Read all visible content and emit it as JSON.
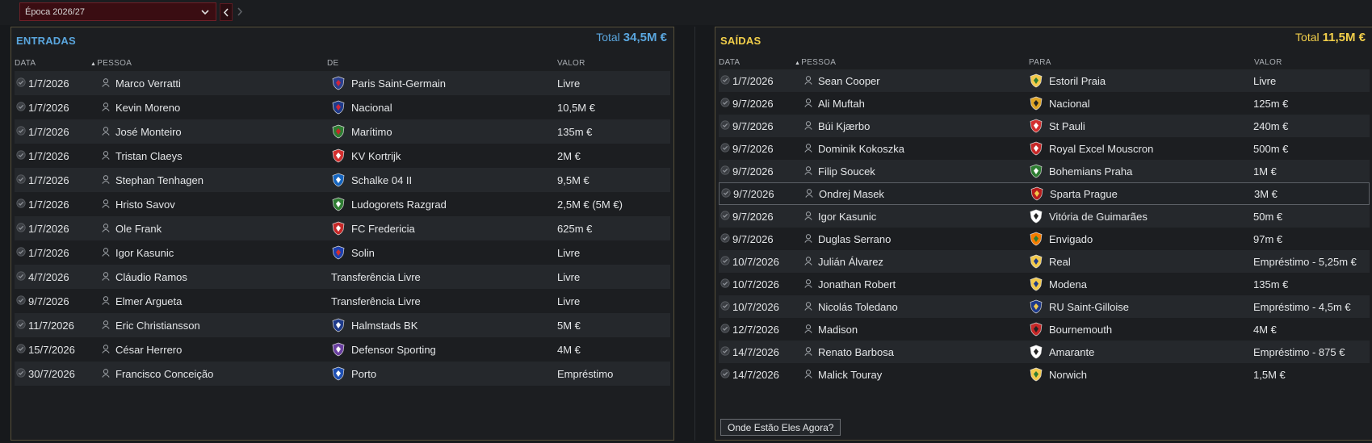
{
  "season": {
    "label": "Época 2026/27"
  },
  "incoming": {
    "title": "ENTRADAS",
    "total_label": "Total",
    "total_value": "34,5M €",
    "headers": {
      "date": "DATA",
      "person": "PESSOA",
      "from": "DE",
      "value": "VALOR"
    },
    "rows": [
      {
        "date": "1/7/2026",
        "name": "Marco Verratti",
        "club": "Paris Saint-Germain",
        "value": "Livre",
        "crest": "#2b3f8f",
        "crest2": "#d0263a"
      },
      {
        "date": "1/7/2026",
        "name": "Kevin Moreno",
        "club": "Nacional",
        "value": "10,5M €",
        "crest": "#1e3a8a",
        "crest2": "#d0263a"
      },
      {
        "date": "1/7/2026",
        "name": "José Monteiro",
        "club": "Marítimo",
        "value": "135m €",
        "crest": "#2e7d32",
        "crest2": "#c62828"
      },
      {
        "date": "1/7/2026",
        "name": "Tristan Claeys",
        "club": "KV Kortrijk",
        "value": "2M €",
        "crest": "#d32f2f",
        "crest2": "#ffffff"
      },
      {
        "date": "1/7/2026",
        "name": "Stephan Tenhagen",
        "club": "Schalke 04 II",
        "value": "9,5M €",
        "crest": "#1565c0",
        "crest2": "#ffffff"
      },
      {
        "date": "1/7/2026",
        "name": "Hristo Savov",
        "club": "Ludogorets Razgrad",
        "value": "2,5M € (5M €)",
        "crest": "#2e7d32",
        "crest2": "#ffffff"
      },
      {
        "date": "1/7/2026",
        "name": "Ole Frank",
        "club": "FC Fredericia",
        "value": "625m €",
        "crest": "#c62828",
        "crest2": "#ffffff"
      },
      {
        "date": "1/7/2026",
        "name": "Igor Kasunic",
        "club": "Solin",
        "value": "Livre",
        "crest": "#1e40af",
        "crest2": "#d32f2f"
      },
      {
        "date": "4/7/2026",
        "name": "Cláudio Ramos",
        "club": "Transferência Livre",
        "value": "Livre",
        "crest": "",
        "crest2": ""
      },
      {
        "date": "9/7/2026",
        "name": "Elmer Argueta",
        "club": "Transferência Livre",
        "value": "Livre",
        "crest": "",
        "crest2": ""
      },
      {
        "date": "11/7/2026",
        "name": "Eric Christiansson",
        "club": "Halmstads BK",
        "value": "5M €",
        "crest": "#1e3a8a",
        "crest2": "#ffffff"
      },
      {
        "date": "15/7/2026",
        "name": "César Herrero",
        "club": "Defensor Sporting",
        "value": "4M €",
        "crest": "#6a3fa0",
        "crest2": "#ffffff"
      },
      {
        "date": "30/7/2026",
        "name": "Francisco Conceição",
        "club": "Porto",
        "value": "Empréstimo",
        "crest": "#1e4fb3",
        "crest2": "#ffffff"
      }
    ]
  },
  "outgoing": {
    "title": "SAÍDAS",
    "total_label": "Total",
    "total_value": "11,5M €",
    "headers": {
      "date": "DATA",
      "person": "PESSOA",
      "to": "PARA",
      "value": "VALOR"
    },
    "rows": [
      {
        "date": "1/7/2026",
        "name": "Sean Cooper",
        "club": "Estoril Praia",
        "value": "Livre",
        "crest": "#f2c94c",
        "crest2": "#2e7d32"
      },
      {
        "date": "9/7/2026",
        "name": "Ali Muftah",
        "club": "Nacional",
        "value": "125m €",
        "crest": "#e0a526",
        "crest2": "#222222"
      },
      {
        "date": "9/7/2026",
        "name": "Búi Kjærbo",
        "club": "St Pauli",
        "value": "240m €",
        "crest": "#d32f2f",
        "crest2": "#ffffff"
      },
      {
        "date": "9/7/2026",
        "name": "Dominik Kokoszka",
        "club": "Royal Excel Mouscron",
        "value": "500m €",
        "crest": "#c62828",
        "crest2": "#ffffff"
      },
      {
        "date": "9/7/2026",
        "name": "Filip Soucek",
        "club": "Bohemians Praha",
        "value": "1M €",
        "crest": "#2e7d32",
        "crest2": "#ffffff"
      },
      {
        "date": "9/7/2026",
        "name": "Ondrej Masek",
        "club": "Sparta Prague",
        "value": "3M €",
        "crest": "#b71c1c",
        "crest2": "#f2c94c"
      },
      {
        "date": "9/7/2026",
        "name": "Igor Kasunic",
        "club": "Vitória de Guimarães",
        "value": "50m €",
        "crest": "#ffffff",
        "crest2": "#222222"
      },
      {
        "date": "9/7/2026",
        "name": "Duglas Serrano",
        "club": "Envigado",
        "value": "97m €",
        "crest": "#f57c00",
        "crest2": "#2e7d32"
      },
      {
        "date": "10/7/2026",
        "name": "Julián Álvarez",
        "club": "Real",
        "value": "Empréstimo - 5,25m €",
        "crest": "#f2c94c",
        "crest2": "#1e3a8a"
      },
      {
        "date": "10/7/2026",
        "name": "Jonathan Robert",
        "club": "Modena",
        "value": "135m €",
        "crest": "#f2c94c",
        "crest2": "#1e3a8a"
      },
      {
        "date": "10/7/2026",
        "name": "Nicolás Toledano",
        "club": "RU Saint-Gilloise",
        "value": "Empréstimo - 4,5m €",
        "crest": "#1e3a8a",
        "crest2": "#f2c94c"
      },
      {
        "date": "12/7/2026",
        "name": "Madison",
        "club": "Bournemouth",
        "value": "4M €",
        "crest": "#c62828",
        "crest2": "#222222"
      },
      {
        "date": "14/7/2026",
        "name": "Renato Barbosa",
        "club": "Amarante",
        "value": "Empréstimo - 875 €",
        "crest": "#ffffff",
        "crest2": "#222222"
      },
      {
        "date": "14/7/2026",
        "name": "Malick Touray",
        "club": "Norwich",
        "value": "1,5M €",
        "crest": "#f2c94c",
        "crest2": "#2e7d32"
      }
    ],
    "more_button": "Onde Estão Eles Agora?"
  }
}
